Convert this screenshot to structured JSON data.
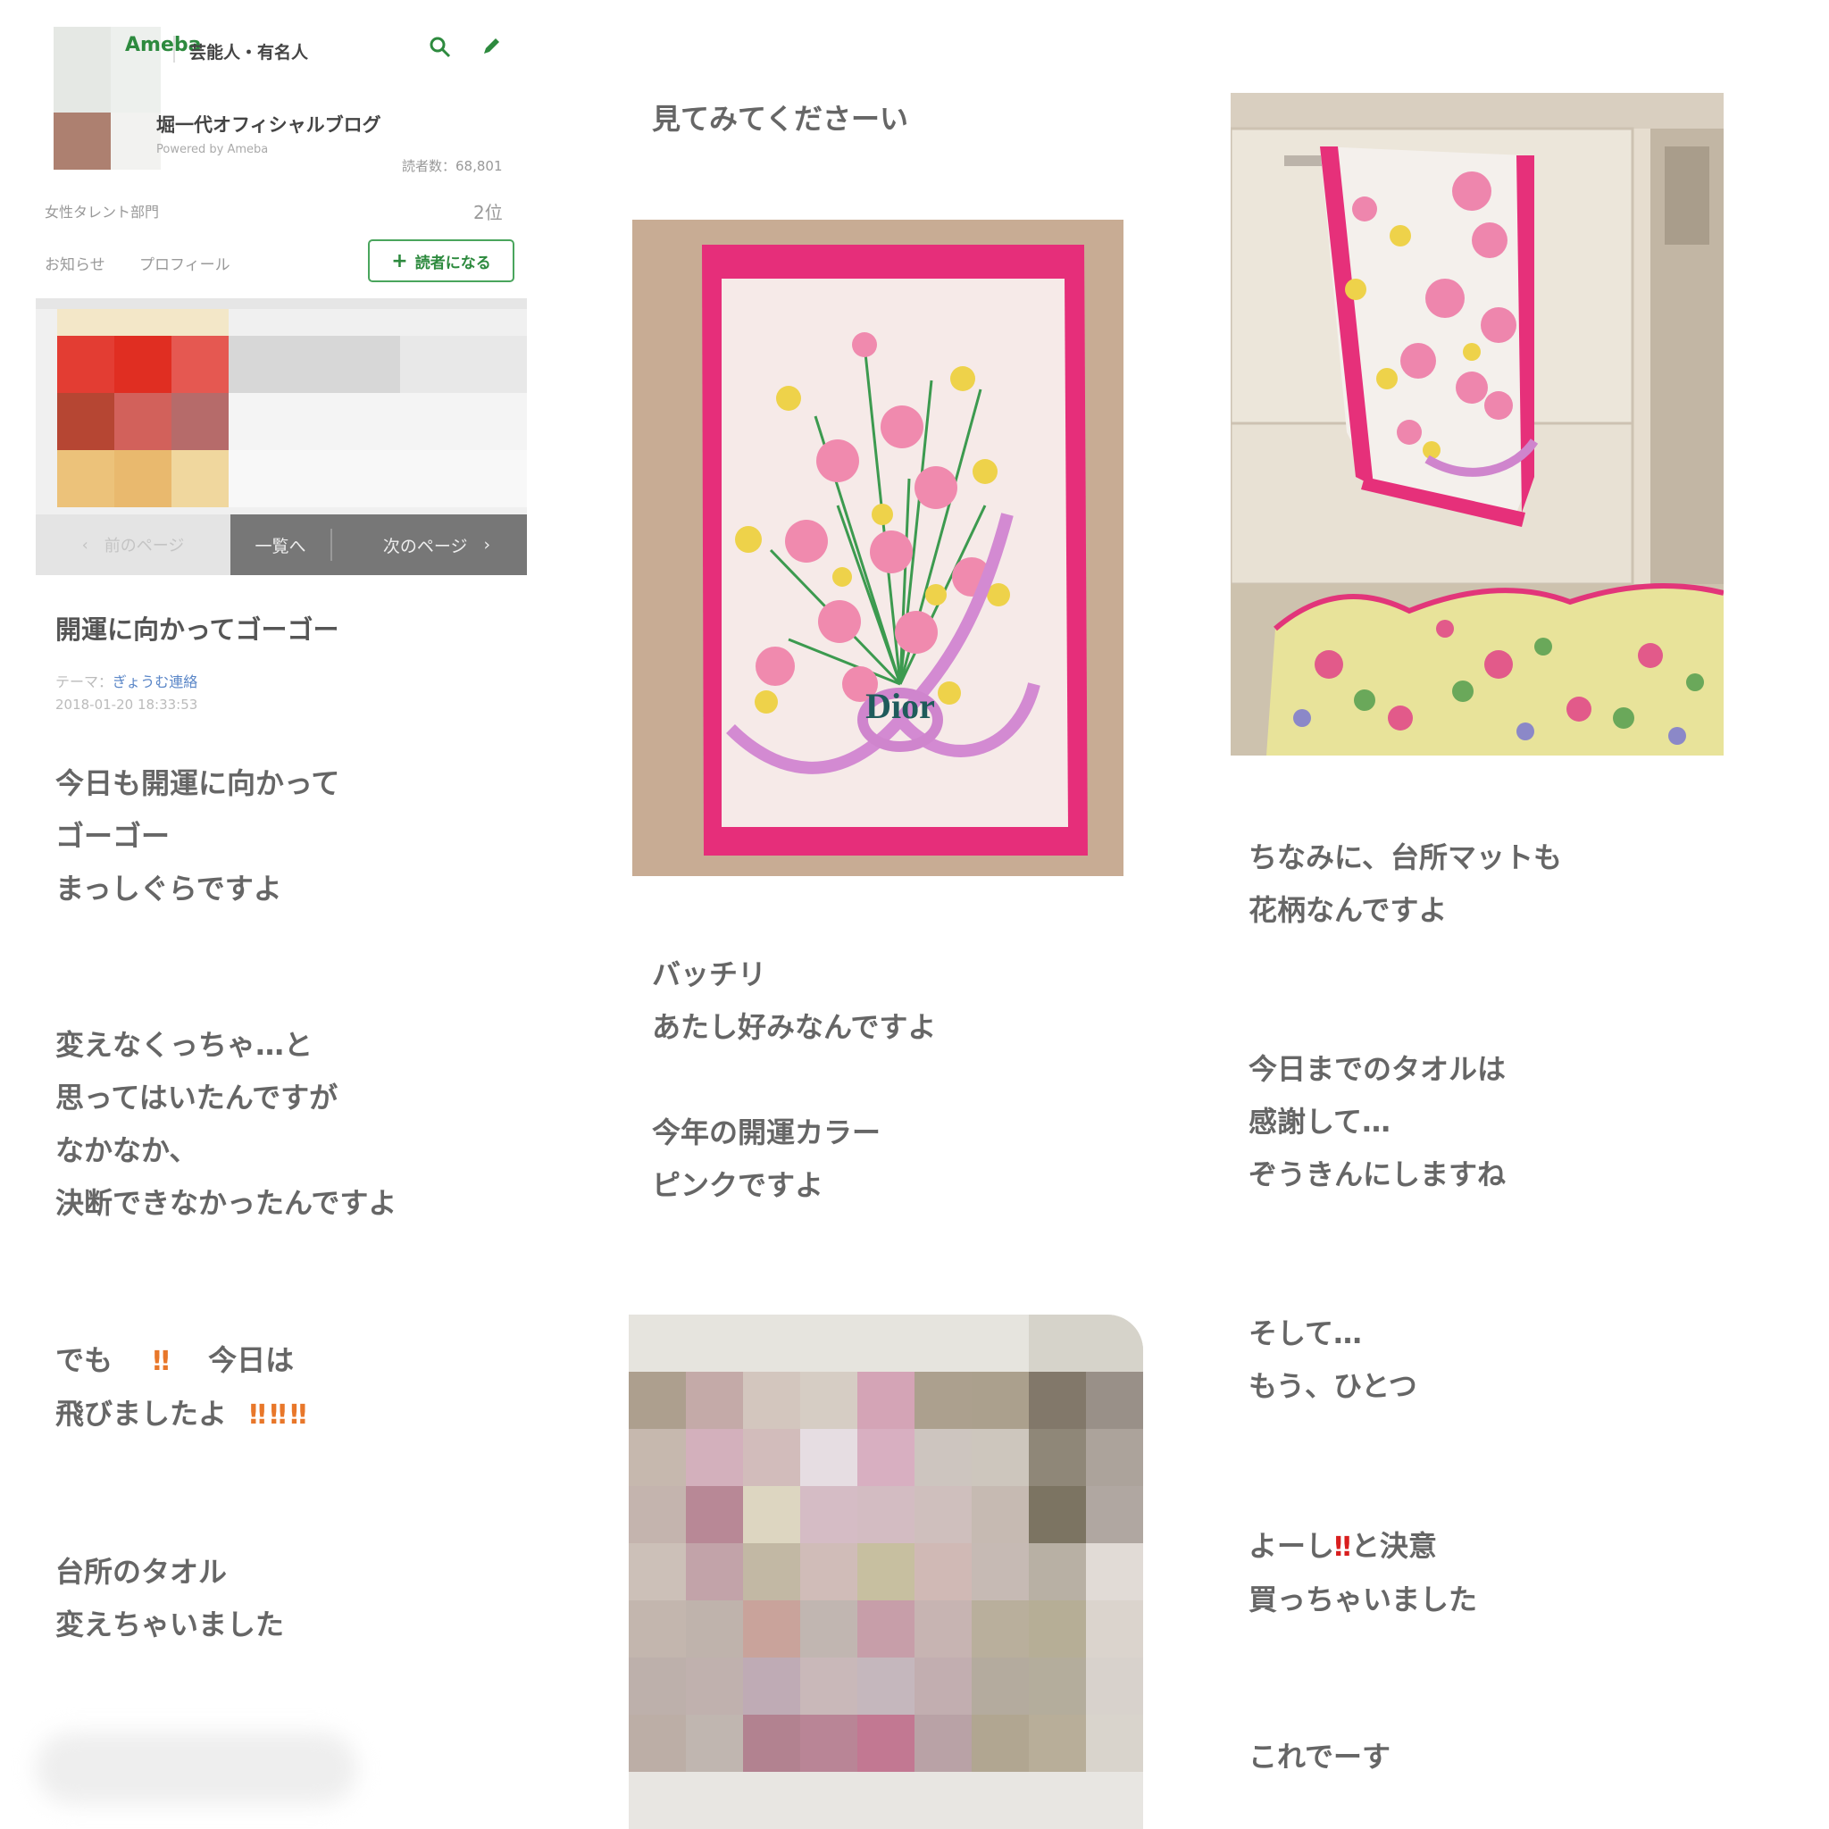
{
  "header": {
    "logo": "Ameba",
    "category": "芸能人・有名人",
    "blog_title": "堀一代オフィシャルブログ",
    "powered": "Powered by Ameba",
    "readers": "読者数：68,801",
    "rank_label": "女性タレント部門",
    "rank_value": "2位",
    "nav": [
      "お知らせ",
      "プロフィール"
    ],
    "follow_label": "読者になる",
    "icons": [
      "search-icon",
      "pencil-icon",
      "plus-icon"
    ]
  },
  "pager": {
    "prev": "前のページ",
    "list": "一覧へ",
    "next": "次のページ"
  },
  "entry": {
    "title": "開運に向かってゴーゴー",
    "theme_label": "テーマ：",
    "theme": "ぎょうむ連絡",
    "date": "2018-01-20 18:33:53"
  },
  "body": {
    "p1": [
      "今日も開運に向かって",
      "ゴーゴー",
      "まっしぐらですよ"
    ],
    "p2": [
      "変えなくっちゃ…と",
      "思ってはいたんですが",
      "なかなか、",
      "決断できなかったんですよ"
    ],
    "p3a": [
      "でも",
      "‼",
      "今日は"
    ],
    "p3b": [
      "飛びましたよ",
      "‼‼‼"
    ],
    "p4": [
      "台所のタオル",
      "変えちゃいました"
    ],
    "p5": [
      "見てみてくださーい"
    ],
    "p6": [
      "バッチリ",
      "あたし好みなんですよ"
    ],
    "p7": [
      "今年の開運カラー",
      "ピンクですよ"
    ],
    "p8": [
      "ちなみに、台所マットも",
      "花柄なんですよ"
    ],
    "p9": [
      "今日までのタオルは",
      "感謝して…",
      "ぞうきんにしますね"
    ],
    "p10": [
      "そして…",
      "もう、ひとつ"
    ],
    "p11a": [
      "よーし",
      "‼",
      "と決意"
    ],
    "p11b": [
      "買っちゃいました"
    ],
    "p12": [
      "これでーす"
    ]
  },
  "photos": {
    "towel_brand": "Dior"
  },
  "colors": {
    "brand_green": "#2d8a3e",
    "link_blue": "#5a86c7",
    "towel_pink": "#e62e7a",
    "bang_orange": "#e8772a",
    "bang_red": "#d91e1e"
  }
}
